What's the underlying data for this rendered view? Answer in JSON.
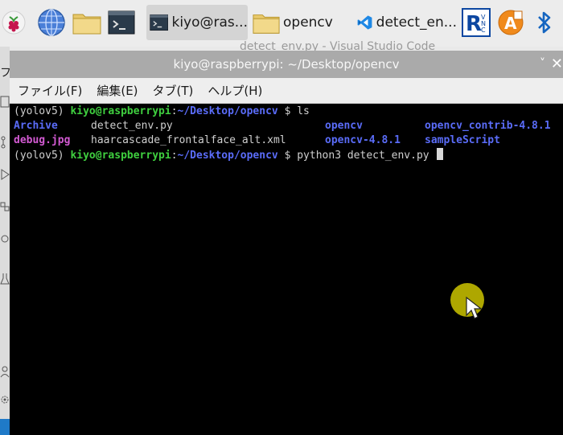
{
  "taskbar": {
    "terminal_button_label": "kiyo@ras...",
    "files_button_label": "opencv",
    "vscode_button_label": "detect_en...",
    "background_window_title": "detect_env.py - Visual Studio Code"
  },
  "left_strip": {
    "partial_text": "フ"
  },
  "window": {
    "title": "kiyo@raspberrypi: ~/Desktop/opencv",
    "chevron": "˅",
    "close": "✕"
  },
  "menu": [
    {
      "label": "ファイル(F)"
    },
    {
      "label": "編集(E)"
    },
    {
      "label": "タブ(T)"
    },
    {
      "label": "ヘルプ(H)"
    }
  ],
  "terminal": {
    "prompt_env": "(yolov5) ",
    "prompt_user": "kiyo@raspberrypi",
    "prompt_sep": ":",
    "prompt_path": "~/Desktop/opencv",
    "prompt_end": " $ ",
    "cmd1": "ls",
    "cmd2": "python3 detect_env.py ",
    "ls_row1": [
      "Archive",
      "detect_env.py",
      "opencv",
      "opencv_contrib-4.8.1"
    ],
    "ls_row2": [
      "debug.jpg",
      "haarcascade_frontalface_alt.xml",
      "opencv-4.8.1",
      "sampleScript"
    ]
  },
  "colors": {
    "terminal_bg": "#000000",
    "prompt_green": "#3fcf3f",
    "directory_blue": "#5a6cf8",
    "image_magenta": "#d35ad3",
    "mouse_highlight": "#b7b000"
  }
}
